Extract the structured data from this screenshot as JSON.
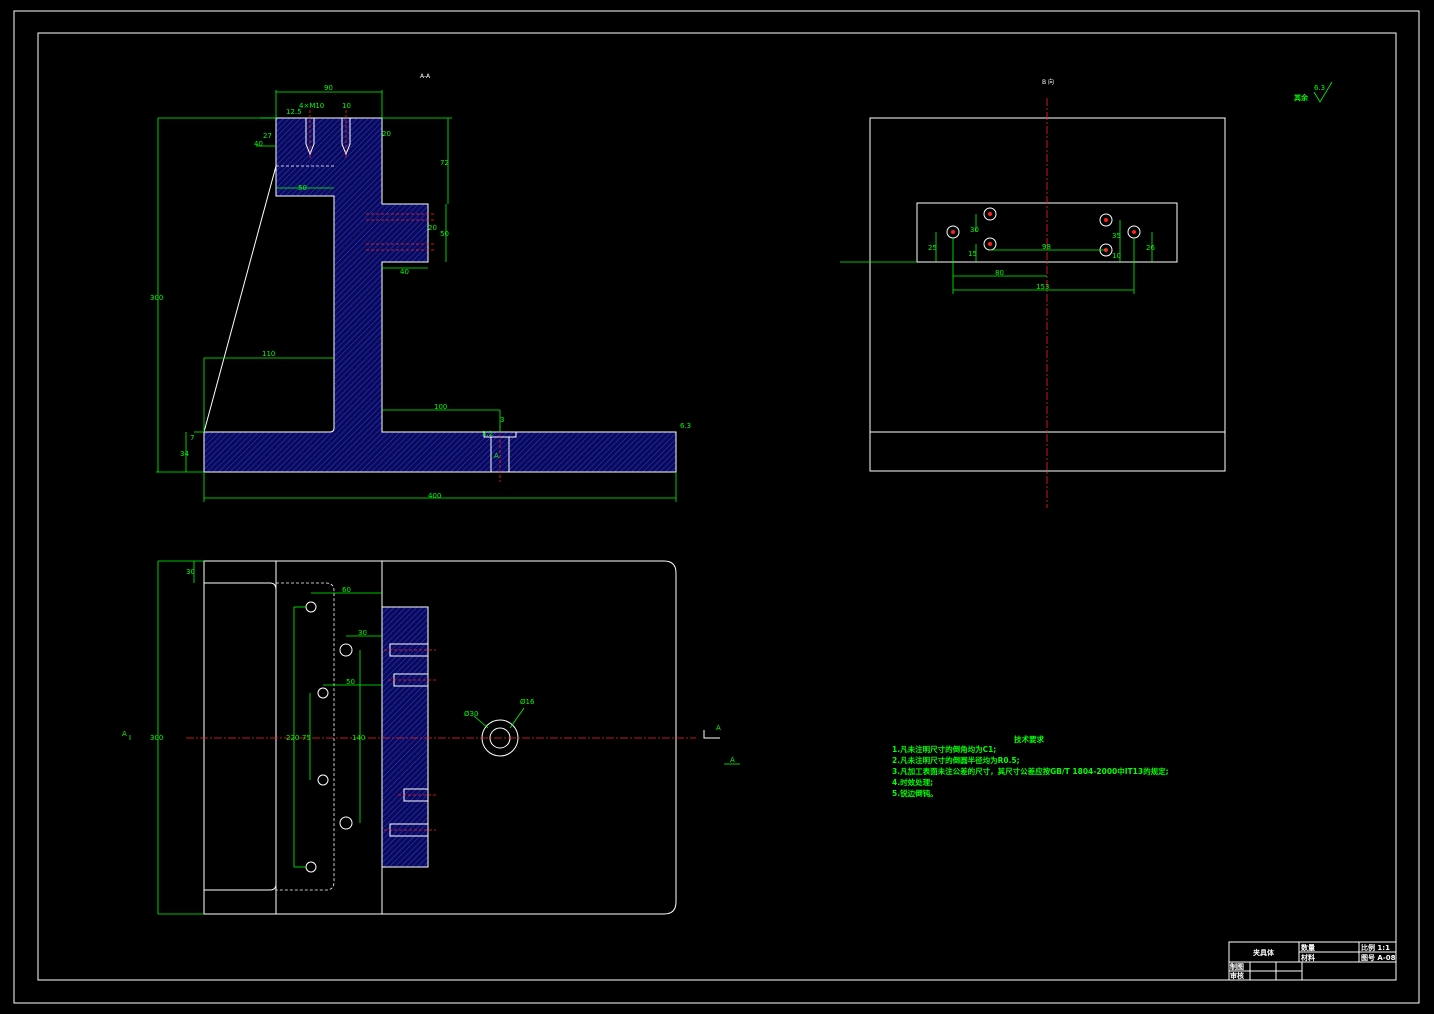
{
  "section_aa_label": "A-A",
  "view_b_label": "B 向",
  "roughness_other": "其余",
  "roughness_values": [
    "12.5",
    "6.3",
    "3.2",
    "6.3"
  ],
  "section_marker": "A",
  "tech_requirements": {
    "title": "技术要求",
    "items": [
      "1.凡未注明尺寸的倒角均为C1;",
      "2.凡未注明尺寸的倒圆半径均为R0.5;",
      "3.凡加工表面未注公差的尺寸，其尺寸公差应按GB/T 1804-2000中IT13的规定;",
      "4.时效处理;",
      "5.锐边倒钝。"
    ]
  },
  "title_block": {
    "part_name": "夹具体",
    "material_label": "数量",
    "material_value": "材料",
    "scale_label": "比例 1:1",
    "drawing_no": "图号 A-08",
    "drawn_by": "制图",
    "checked_by": "审核"
  },
  "dims_front": {
    "top_width": "90",
    "hole_spec": "4×M10",
    "hole_gap": "10",
    "top_a": "27",
    "top_b": "40",
    "top_c": "20",
    "right_upper": "72",
    "inner_width": "50",
    "boss_a": "20",
    "boss_b": "50",
    "boss_w": "40",
    "overall_h": "300",
    "inner_110": "110",
    "step_100": "100",
    "step_3": "3",
    "base_7": "7",
    "base_34": "34",
    "overall_w": "400"
  },
  "dims_top": {
    "d30": "30",
    "d60": "60",
    "d30b": "30",
    "d50": "50",
    "d300": "300",
    "d220": "220",
    "d75": "75",
    "d140": "140",
    "dia_outer": "Ø30",
    "dia_inner": "Ø16"
  },
  "dims_b": {
    "a25": "25",
    "a30": "30",
    "a15": "15",
    "a80": "80",
    "a98": "98",
    "a153": "153",
    "a35": "35",
    "a10": "10",
    "a26": "26"
  }
}
